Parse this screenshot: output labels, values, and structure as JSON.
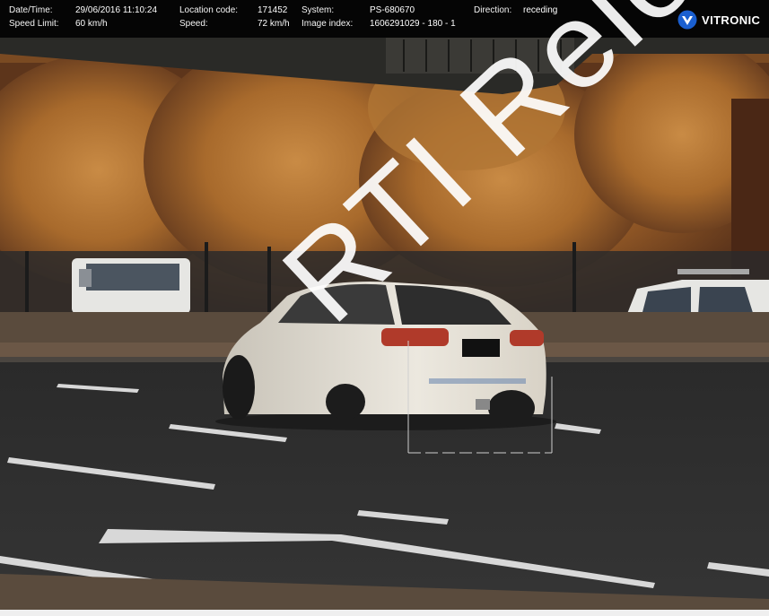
{
  "overlay": {
    "datetime_label": "Date/Time:",
    "datetime_value": "29/06/2016 11:10:24",
    "location_label": "Location code:",
    "location_value": "171452",
    "system_label": "System:",
    "system_value": "PS-680670",
    "direction_label": "Direction:",
    "direction_value": "receding",
    "speed_limit_label": "Speed Limit:",
    "speed_limit_value": "60 km/h",
    "speed_label": "Speed:",
    "speed_value": "72 km/h",
    "image_index_label": "Image index:",
    "image_index_value": "1606291029 - 180 - 1"
  },
  "brand": {
    "name": "VITRONIC",
    "icon": "vitronic-logo-icon",
    "color": "#1a5fd0"
  },
  "watermark": "RTI Rele",
  "colors": {
    "header_bg": "#050505",
    "foliage": "#a86a2c",
    "road": "#2d2d2d",
    "barrier": "#5b4a3a",
    "car": "#d9d4ca"
  }
}
